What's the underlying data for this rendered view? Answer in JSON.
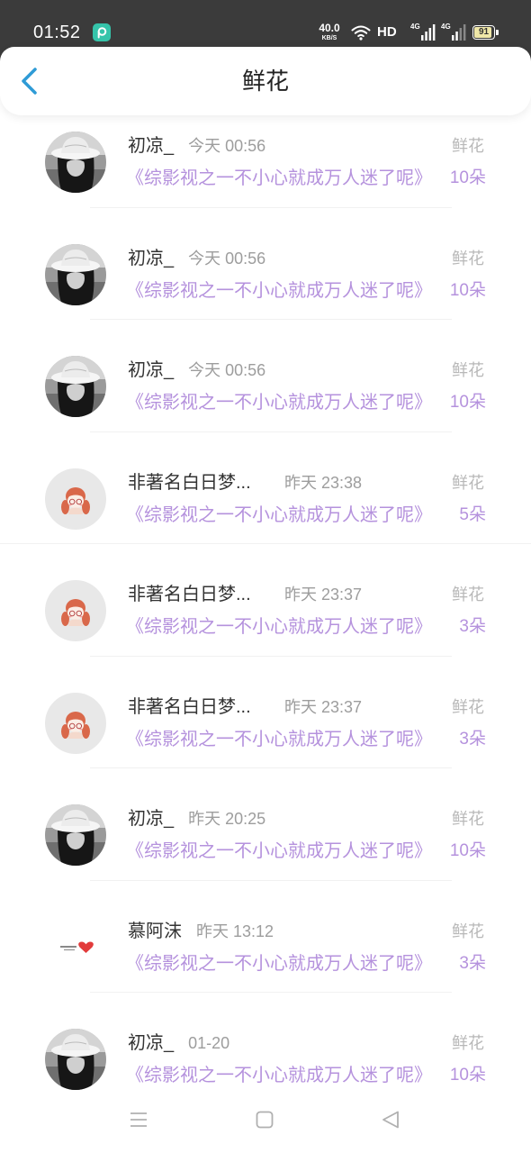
{
  "status_bar": {
    "time": "01:52",
    "app_icon": "app-notification-icon",
    "net_speed_value": "40.0",
    "net_speed_unit": "KB/S",
    "wifi_icon": "wifi-icon",
    "hd_label": "HD",
    "signal1_label": "4G",
    "signal2_label": "4G",
    "battery_level": "91"
  },
  "header": {
    "title": "鲜花",
    "back_icon": "chevron-left-icon"
  },
  "items": [
    {
      "name": "初凉_",
      "time": "今天 00:56",
      "tag": "鲜花",
      "book": "《综影视之一不小心就成万人迷了呢》",
      "count": "10朵",
      "avatar": "photo-avatar"
    },
    {
      "name": "初凉_",
      "time": "今天 00:56",
      "tag": "鲜花",
      "book": "《综影视之一不小心就成万人迷了呢》",
      "count": "10朵",
      "avatar": "photo-avatar"
    },
    {
      "name": "初凉_",
      "time": "今天 00:56",
      "tag": "鲜花",
      "book": "《综影视之一不小心就成万人迷了呢》",
      "count": "10朵",
      "avatar": "photo-avatar"
    },
    {
      "name": "非著名白日梦...",
      "time": "昨天 23:38",
      "tag": "鲜花",
      "book": "《综影视之一不小心就成万人迷了呢》",
      "count": "5朵",
      "avatar": "cartoon-girl-avatar"
    },
    {
      "name": "非著名白日梦...",
      "time": "昨天 23:37",
      "tag": "鲜花",
      "book": "《综影视之一不小心就成万人迷了呢》",
      "count": "3朵",
      "avatar": "cartoon-girl-avatar"
    },
    {
      "name": "非著名白日梦...",
      "time": "昨天 23:37",
      "tag": "鲜花",
      "book": "《综影视之一不小心就成万人迷了呢》",
      "count": "3朵",
      "avatar": "cartoon-girl-avatar"
    },
    {
      "name": "初凉_",
      "time": "昨天 20:25",
      "tag": "鲜花",
      "book": "《综影视之一不小心就成万人迷了呢》",
      "count": "10朵",
      "avatar": "photo-avatar"
    },
    {
      "name": "慕阿沫",
      "time": "昨天 13:12",
      "tag": "鲜花",
      "book": "《综影视之一不小心就成万人迷了呢》",
      "count": "3朵",
      "avatar": "heart-avatar"
    },
    {
      "name": "初凉_",
      "time": "01-20",
      "tag": "鲜花",
      "book": "《综影视之一不小心就成万人迷了呢》",
      "count": "10朵",
      "avatar": "photo-avatar"
    }
  ],
  "nav_bar": {
    "menu_icon": "menu-icon",
    "home_icon": "square-home-icon",
    "back_icon": "triangle-back-icon"
  },
  "colors": {
    "accent": "#b592dd",
    "statusbar": "#3b3b3b",
    "backarrow": "#2e9bd6",
    "muted": "#b8b8b8"
  }
}
